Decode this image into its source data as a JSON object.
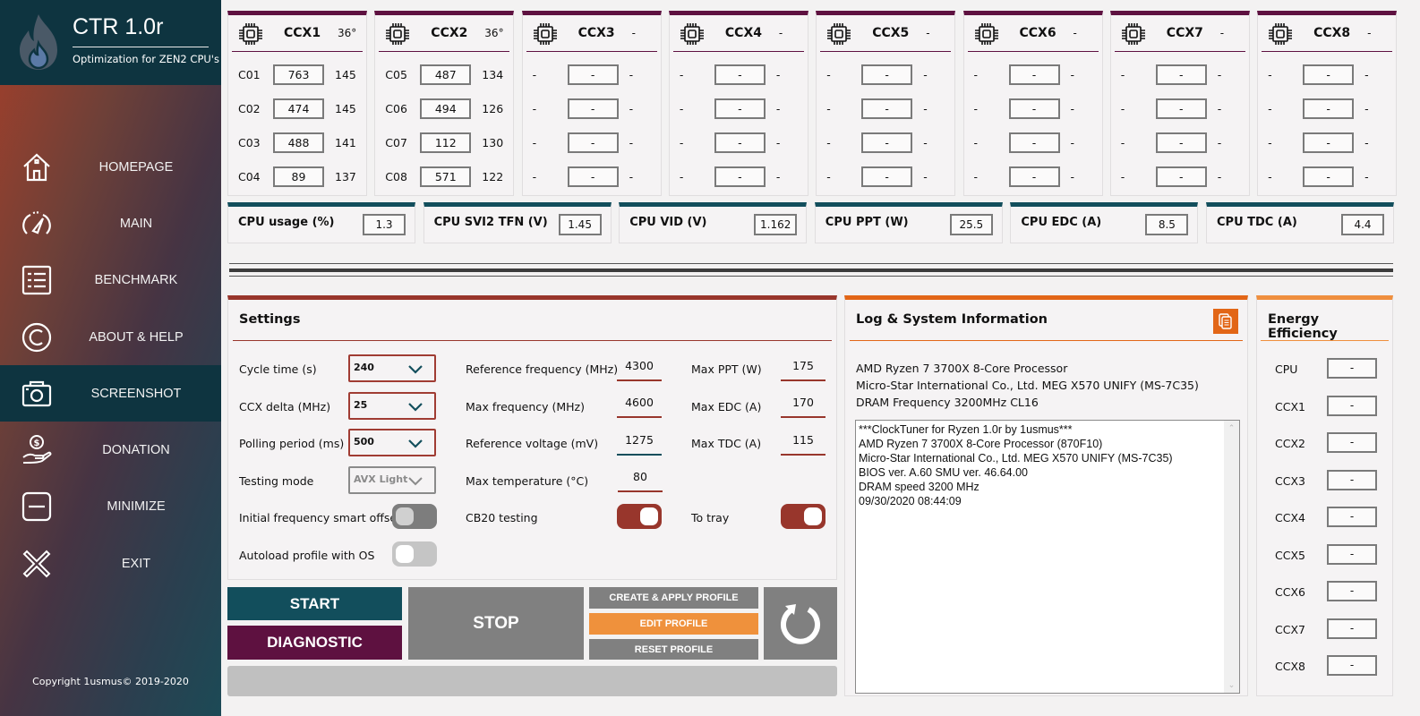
{
  "app": {
    "title": "CTR 1.0r",
    "subtitle": "Optimization for ZEN2 CPU's",
    "copyright": "Copyright 1usmus© 2019-2020"
  },
  "sidebar": {
    "items": [
      {
        "label": "HOMEPAGE",
        "icon": "home-icon",
        "active": false
      },
      {
        "label": "MAIN",
        "icon": "speedometer-icon",
        "active": false
      },
      {
        "label": "BENCHMARK",
        "icon": "list-icon",
        "active": false
      },
      {
        "label": "ABOUT & HELP",
        "icon": "copyright-icon",
        "active": false
      },
      {
        "label": "SCREENSHOT",
        "icon": "camera-icon",
        "active": true
      },
      {
        "label": "DONATION",
        "icon": "donation-hand-icon",
        "active": false
      },
      {
        "label": "MINIMIZE",
        "icon": "minimize-icon",
        "active": false
      },
      {
        "label": "EXIT",
        "icon": "close-icon",
        "active": false
      }
    ]
  },
  "ccx": [
    {
      "name": "CCX1",
      "temp": "36°",
      "cores": [
        {
          "name": "C01",
          "value": "763",
          "extra": "145"
        },
        {
          "name": "C02",
          "value": "474",
          "extra": "145"
        },
        {
          "name": "C03",
          "value": "488",
          "extra": "141"
        },
        {
          "name": "C04",
          "value": "89",
          "extra": "137"
        }
      ]
    },
    {
      "name": "CCX2",
      "temp": "36°",
      "cores": [
        {
          "name": "C05",
          "value": "487",
          "extra": "134"
        },
        {
          "name": "C06",
          "value": "494",
          "extra": "126"
        },
        {
          "name": "C07",
          "value": "112",
          "extra": "130"
        },
        {
          "name": "C08",
          "value": "571",
          "extra": "122"
        }
      ]
    },
    {
      "name": "CCX3",
      "temp": "-",
      "cores": [
        {
          "name": "-",
          "value": "-",
          "extra": "-"
        },
        {
          "name": "-",
          "value": "-",
          "extra": "-"
        },
        {
          "name": "-",
          "value": "-",
          "extra": "-"
        },
        {
          "name": "-",
          "value": "-",
          "extra": "-"
        }
      ]
    },
    {
      "name": "CCX4",
      "temp": "-",
      "cores": [
        {
          "name": "-",
          "value": "-",
          "extra": "-"
        },
        {
          "name": "-",
          "value": "-",
          "extra": "-"
        },
        {
          "name": "-",
          "value": "-",
          "extra": "-"
        },
        {
          "name": "-",
          "value": "-",
          "extra": "-"
        }
      ]
    },
    {
      "name": "CCX5",
      "temp": "-",
      "cores": [
        {
          "name": "-",
          "value": "-",
          "extra": "-"
        },
        {
          "name": "-",
          "value": "-",
          "extra": "-"
        },
        {
          "name": "-",
          "value": "-",
          "extra": "-"
        },
        {
          "name": "-",
          "value": "-",
          "extra": "-"
        }
      ]
    },
    {
      "name": "CCX6",
      "temp": "-",
      "cores": [
        {
          "name": "-",
          "value": "-",
          "extra": "-"
        },
        {
          "name": "-",
          "value": "-",
          "extra": "-"
        },
        {
          "name": "-",
          "value": "-",
          "extra": "-"
        },
        {
          "name": "-",
          "value": "-",
          "extra": "-"
        }
      ]
    },
    {
      "name": "CCX7",
      "temp": "-",
      "cores": [
        {
          "name": "-",
          "value": "-",
          "extra": "-"
        },
        {
          "name": "-",
          "value": "-",
          "extra": "-"
        },
        {
          "name": "-",
          "value": "-",
          "extra": "-"
        },
        {
          "name": "-",
          "value": "-",
          "extra": "-"
        }
      ]
    },
    {
      "name": "CCX8",
      "temp": "-",
      "cores": [
        {
          "name": "-",
          "value": "-",
          "extra": "-"
        },
        {
          "name": "-",
          "value": "-",
          "extra": "-"
        },
        {
          "name": "-",
          "value": "-",
          "extra": "-"
        },
        {
          "name": "-",
          "value": "-",
          "extra": "-"
        }
      ]
    }
  ],
  "stats": [
    {
      "label": "CPU usage (%)",
      "value": "1.3"
    },
    {
      "label": "CPU SVI2 TFN (V)",
      "value": "1.45"
    },
    {
      "label": "CPU VID (V)",
      "value": "1.162"
    },
    {
      "label": "CPU PPT (W)",
      "value": "25.5"
    },
    {
      "label": "CPU EDC (A)",
      "value": "8.5"
    },
    {
      "label": "CPU TDC (A)",
      "value": "4.4"
    }
  ],
  "settings": {
    "title": "Settings",
    "dropdowns": [
      {
        "label": "Cycle time (s)",
        "value": "240",
        "enabled": true
      },
      {
        "label": "CCX delta (MHz)",
        "value": "25",
        "enabled": true
      },
      {
        "label": "Polling period (ms)",
        "value": "500",
        "enabled": true
      },
      {
        "label": "Testing mode",
        "value": "AVX Light",
        "enabled": false
      }
    ],
    "toggles_left": [
      {
        "label": "Initial frequency smart offset",
        "on": false
      },
      {
        "label": "Autoload profile with OS",
        "on": false
      }
    ],
    "fields_mid": [
      {
        "label": "Reference frequency (MHz)",
        "value": "4300"
      },
      {
        "label": "Max frequency (MHz)",
        "value": "4600"
      },
      {
        "label": "Reference voltage (mV)",
        "value": "1275"
      },
      {
        "label": "Max temperature (°C)",
        "value": "80"
      }
    ],
    "fields_right": [
      {
        "label": "Max PPT (W)",
        "value": "175"
      },
      {
        "label": "Max EDC (A)",
        "value": "170"
      },
      {
        "label": "Max TDC (A)",
        "value": "115"
      }
    ],
    "cb20": {
      "label": "CB20 testing",
      "on": true
    },
    "tray": {
      "label": "To tray",
      "on": true
    }
  },
  "buttons": {
    "start": "START",
    "diagnostic": "DIAGNOSTIC",
    "stop": "STOP",
    "create_apply": "CREATE & APPLY PROFILE",
    "edit": "EDIT PROFILE",
    "reset": "RESET PROFILE"
  },
  "progress": {
    "value": 0
  },
  "log": {
    "title": "Log & System Information",
    "info": [
      "AMD Ryzen 7 3700X 8-Core Processor",
      "Micro-Star International Co., Ltd. MEG X570 UNIFY (MS-7C35)",
      "DRAM Frequency 3200MHz CL16"
    ],
    "lines": [
      "***ClockTuner for Ryzen 1.0r by 1usmus***",
      "AMD Ryzen 7 3700X 8-Core Processor (870F10)",
      "Micro-Star International Co., Ltd. MEG X570 UNIFY (MS-7C35)",
      "BIOS ver. A.60 SMU ver. 46.64.00",
      "DRAM speed 3200 MHz",
      "09/30/2020 08:44:09"
    ]
  },
  "energy": {
    "title": "Energy Efficiency",
    "rows": [
      {
        "label": "CPU",
        "value": "-"
      },
      {
        "label": "CCX1",
        "value": "-"
      },
      {
        "label": "CCX2",
        "value": "-"
      },
      {
        "label": "CCX3",
        "value": "-"
      },
      {
        "label": "CCX4",
        "value": "-"
      },
      {
        "label": "CCX5",
        "value": "-"
      },
      {
        "label": "CCX6",
        "value": "-"
      },
      {
        "label": "CCX7",
        "value": "-"
      },
      {
        "label": "CCX8",
        "value": "-"
      }
    ]
  },
  "colors": {
    "sidebar_brand": "#0e3440",
    "ccx_accent": "#5e1140",
    "stat_accent": "#124e5c",
    "settings_accent": "#98362c",
    "log_accent": "#e26617",
    "energy_accent": "#ef8f3e",
    "start_button": "#124e5c",
    "diagnostic_button": "#5e1140",
    "gray_button": "#808080",
    "edit_button": "#ef913c"
  }
}
